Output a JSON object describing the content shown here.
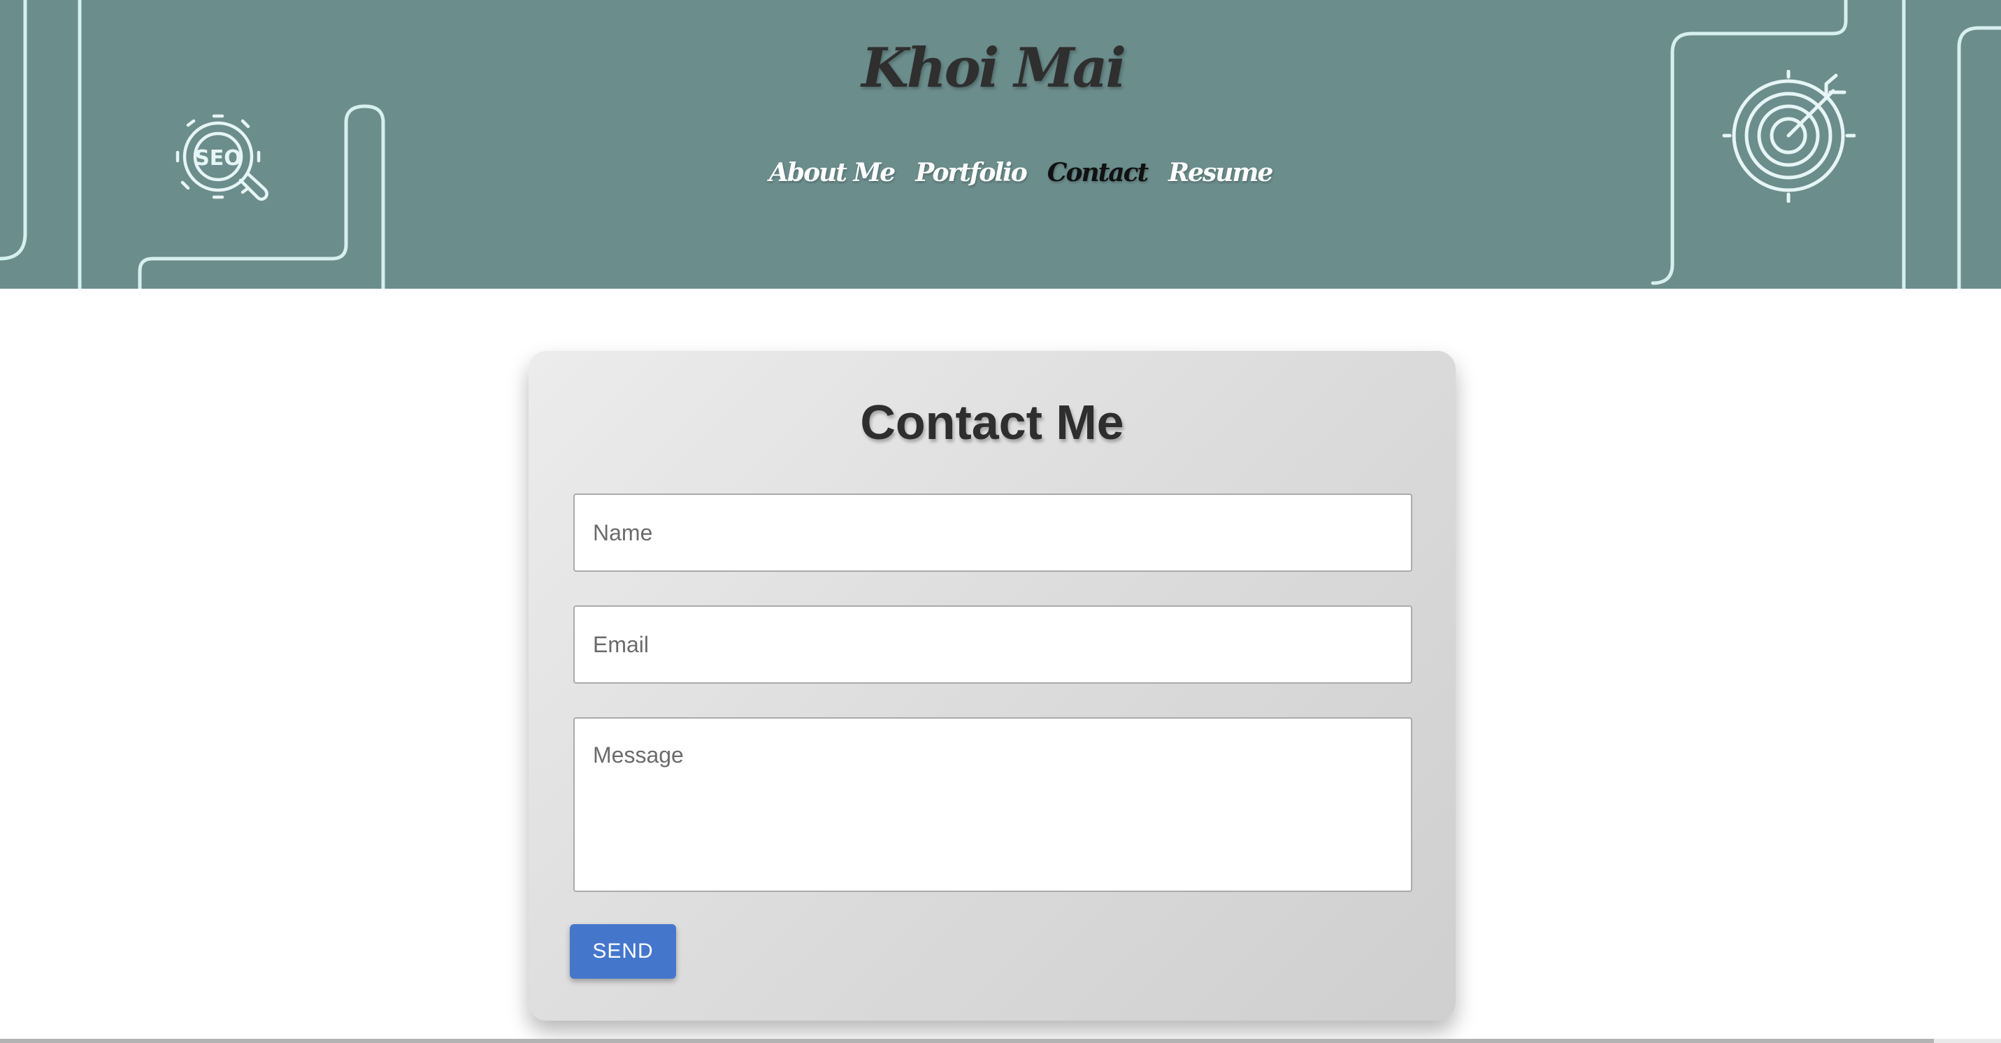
{
  "header": {
    "title": "Khoi Mai",
    "background": "#6b8d8c",
    "line_color": "#d6efef",
    "left_icon": "seo-gear-icon",
    "right_icon": "target-icon",
    "left_icon_text": "SEO"
  },
  "nav": {
    "items": [
      {
        "label": "About Me",
        "active": false
      },
      {
        "label": "Portfolio",
        "active": false
      },
      {
        "label": "Contact",
        "active": true
      },
      {
        "label": "Resume",
        "active": false
      }
    ]
  },
  "contact": {
    "title": "Contact Me",
    "name_placeholder": "Name",
    "email_placeholder": "Email",
    "message_placeholder": "Message",
    "send_label": "SEND",
    "accent": "#4477cc"
  }
}
